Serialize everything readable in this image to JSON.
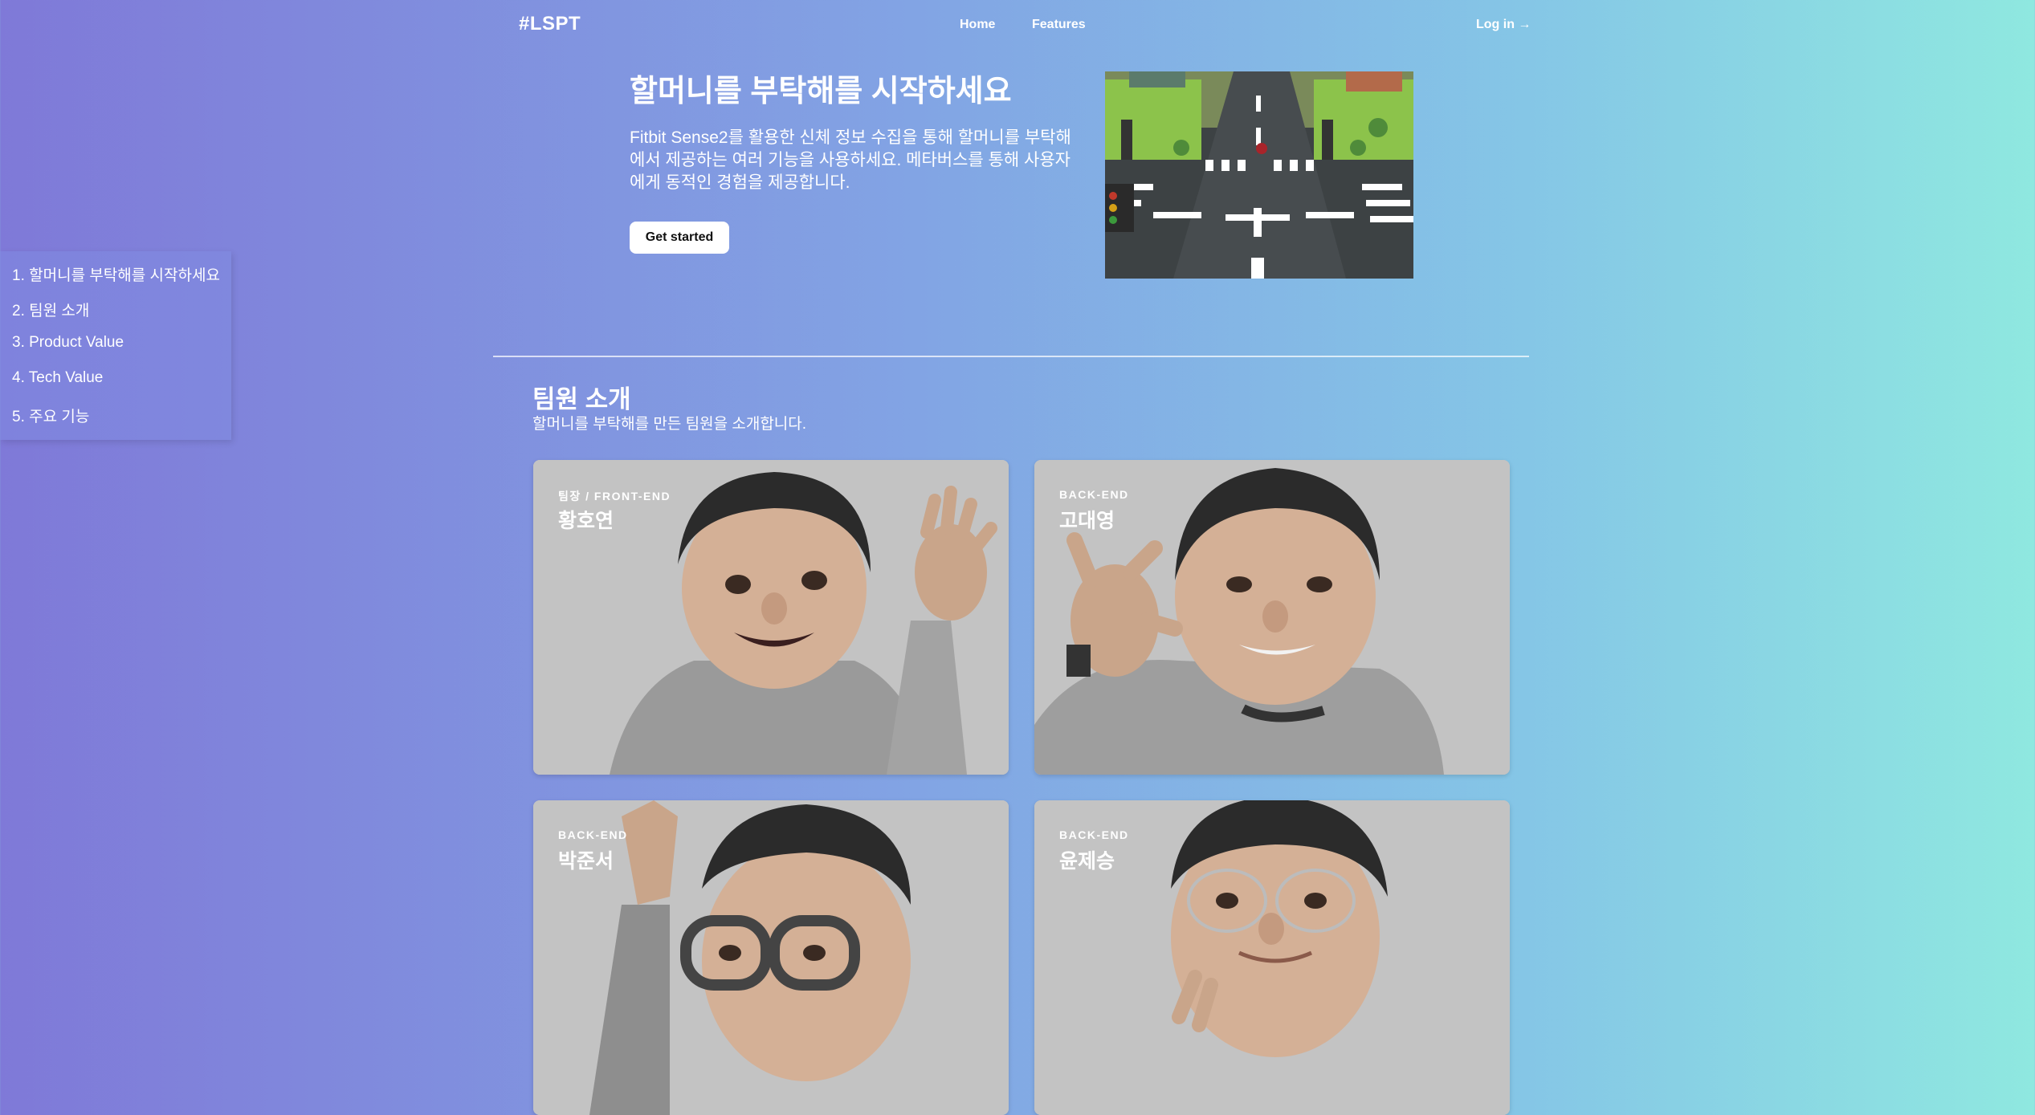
{
  "nav": {
    "logo": "#LSPT",
    "links": [
      {
        "label": "Home"
      },
      {
        "label": "Features"
      }
    ],
    "login": "Log in →"
  },
  "hero": {
    "title": "할머니를 부탁해를 시작하세요",
    "description": "Fitbit Sense2를 활용한 신체 정보 수집을 통해 할머니를 부탁해에서 제공하는 여러 기능을 사용하세요. 메타버스를 통해 사용자에게 동적인 경험을 제공합니다.",
    "cta": "Get started"
  },
  "toc": {
    "items": [
      {
        "label": "1. 할머니를 부탁해를 시작하세요"
      },
      {
        "label": "2. 팀원 소개"
      },
      {
        "label": "3. Product Value"
      },
      {
        "label": "4. Tech Value"
      },
      {
        "label": "5. 주요 기능"
      }
    ]
  },
  "team": {
    "title": "팀원 소개",
    "subtitle": "할머니를 부탁해를 만든 팀원을 소개합니다.",
    "members": [
      {
        "role": "팀장 / FRONT-END",
        "name": "황호연"
      },
      {
        "role": "BACK-END",
        "name": "고대영"
      },
      {
        "role": "BACK-END",
        "name": "박준서"
      },
      {
        "role": "BACK-END",
        "name": "윤제승"
      }
    ]
  },
  "colors": {
    "gradient_start": "#7f79d8",
    "gradient_end": "#8fe8e0",
    "card_bg": "#c3c3c3"
  }
}
